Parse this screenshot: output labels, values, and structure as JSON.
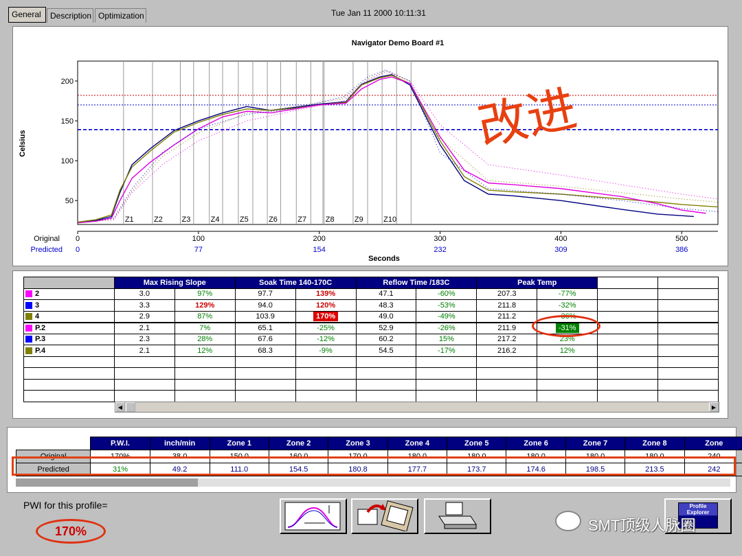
{
  "tabs": [
    "General",
    "Description",
    "Optimization"
  ],
  "timestamp": "Tue Jan 11 2000 10:11:31",
  "chart_data": {
    "type": "line",
    "title": "Navigator Demo Board #1",
    "ylabel": "Celsius",
    "xlabel": "Seconds",
    "xlim": [
      0,
      530
    ],
    "ylim": [
      20,
      225
    ],
    "yticks": [
      50,
      100,
      150,
      200
    ],
    "x_original_ticks": [
      0,
      100,
      200,
      300,
      400,
      500
    ],
    "x_predicted_tick_labels": [
      "0",
      "77",
      "154",
      "232",
      "309",
      "386"
    ],
    "x_row_labels": {
      "original": "Original",
      "predicted": "Predicted"
    },
    "zones": [
      {
        "label": "Z1",
        "x": 38
      },
      {
        "label": "Z2",
        "x": 62
      },
      {
        "label": "Z3",
        "x": 85
      },
      {
        "label": "Z4",
        "x": 109
      },
      {
        "label": "Z5",
        "x": 133
      },
      {
        "label": "Z6",
        "x": 157
      },
      {
        "label": "Z7",
        "x": 181
      },
      {
        "label": "Z8",
        "x": 204
      },
      {
        "label": "Z9",
        "x": 228
      },
      {
        "label": "Z10",
        "x": 252
      }
    ],
    "zone_extra_lines": [
      96,
      120,
      145,
      168,
      193,
      203,
      240,
      264,
      276
    ],
    "hlines": [
      {
        "y": 182,
        "color": "#cc0000",
        "style": "dotted"
      },
      {
        "y": 170,
        "color": "#0000cc",
        "style": "dotted"
      },
      {
        "y": 139,
        "color": "#0000cc",
        "style": "dashed"
      }
    ],
    "series": [
      {
        "color": "#000080",
        "x": [
          0,
          15,
          28,
          35,
          45,
          60,
          80,
          100,
          120,
          140,
          160,
          180,
          200,
          222,
          235,
          250,
          260,
          275,
          300,
          320,
          340,
          360,
          400,
          450,
          480,
          500,
          510
        ],
        "y": [
          23,
          25,
          30,
          60,
          95,
          115,
          138,
          150,
          160,
          168,
          163,
          167,
          171,
          174,
          196,
          205,
          208,
          195,
          120,
          75,
          58,
          56,
          50,
          39,
          33,
          31,
          30
        ]
      },
      {
        "color": "#808000",
        "x": [
          0,
          15,
          28,
          35,
          45,
          60,
          80,
          100,
          120,
          140,
          160,
          180,
          200,
          222,
          235,
          250,
          260,
          275,
          300,
          320,
          340,
          360,
          400,
          450,
          480,
          500,
          530
        ],
        "y": [
          23,
          26,
          32,
          63,
          92,
          112,
          136,
          148,
          158,
          165,
          163,
          166,
          170,
          173,
          195,
          204,
          207,
          197,
          125,
          80,
          63,
          61,
          58,
          52,
          48,
          45,
          42
        ]
      },
      {
        "color": "#e000e0",
        "x": [
          0,
          15,
          28,
          35,
          45,
          60,
          80,
          100,
          120,
          140,
          160,
          180,
          200,
          222,
          235,
          250,
          260,
          275,
          300,
          320,
          340,
          360,
          400,
          450,
          480,
          500,
          520
        ],
        "y": [
          22,
          24,
          28,
          50,
          78,
          98,
          120,
          140,
          155,
          162,
          160,
          165,
          170,
          172,
          190,
          202,
          205,
          197,
          130,
          88,
          72,
          70,
          65,
          55,
          46,
          38,
          34
        ]
      },
      {
        "color": "#e000e0",
        "style": "dotted",
        "x": [
          0,
          30,
          45,
          70,
          100,
          140,
          180,
          220,
          240,
          255,
          275,
          300,
          340,
          400,
          450,
          500,
          530
        ],
        "y": [
          22,
          26,
          60,
          95,
          125,
          150,
          163,
          175,
          200,
          212,
          200,
          145,
          95,
          82,
          70,
          58,
          52
        ]
      },
      {
        "color": "#0000cc",
        "style": "dotted",
        "x": [
          0,
          30,
          45,
          70,
          100,
          140,
          180,
          220,
          240,
          255,
          275,
          300,
          340,
          400,
          450,
          500,
          530
        ],
        "y": [
          22,
          28,
          65,
          110,
          140,
          158,
          166,
          180,
          205,
          214,
          200,
          110,
          65,
          58,
          50,
          40,
          36
        ]
      },
      {
        "color": "#808000",
        "style": "dotted",
        "x": [
          0,
          30,
          45,
          70,
          100,
          140,
          180,
          220,
          240,
          255,
          275,
          300,
          340,
          400,
          450,
          500,
          530
        ],
        "y": [
          22,
          27,
          62,
          105,
          135,
          160,
          168,
          178,
          202,
          213,
          200,
          128,
          75,
          68,
          60,
          52,
          48
        ]
      }
    ]
  },
  "annotation_cjk": "改进",
  "grid": {
    "headers": [
      "Max Rising Slope",
      "Soak Time 140-170C",
      "Reflow Time /183C",
      "Peak Temp"
    ],
    "rows": [
      {
        "label": "2",
        "color": "#ff00ff",
        "cells": [
          "3.0",
          "97%",
          "97.7",
          "139%",
          "47.1",
          "-60%",
          "207.3",
          "-77%"
        ]
      },
      {
        "label": "3",
        "color": "#0000ff",
        "cells": [
          "3.3",
          "129%",
          "94.0",
          "120%",
          "48.3",
          "-53%",
          "211.8",
          "-32%"
        ]
      },
      {
        "label": "4",
        "color": "#808000",
        "cells": [
          "2.9",
          "87%",
          "103.9",
          "170%",
          "49.0",
          "-49%",
          "211.2",
          "-36%"
        ]
      },
      {
        "label": "P.2",
        "color": "#ff00ff",
        "cells": [
          "2.1",
          "7%",
          "65.1",
          "-25%",
          "52.9",
          "-26%",
          "211.9",
          "-31%"
        ]
      },
      {
        "label": "P.3",
        "color": "#0000ff",
        "cells": [
          "2.3",
          "28%",
          "67.6",
          "-12%",
          "60.2",
          "15%",
          "217.2",
          "23%"
        ]
      },
      {
        "label": "P.4",
        "color": "#808000",
        "cells": [
          "2.1",
          "12%",
          "68.3",
          "-9%",
          "54.5",
          "-17%",
          "216.2",
          "12%"
        ]
      }
    ]
  },
  "bottom": {
    "headers": [
      "P.W.I.",
      "inch/min",
      "Zone 1",
      "Zone 2",
      "Zone 3",
      "Zone 4",
      "Zone 5",
      "Zone 6",
      "Zone 7",
      "Zone 8",
      "Zone"
    ],
    "original_label": "Original",
    "original": [
      "170%",
      "38.0",
      "150.0",
      "160.0",
      "170.0",
      "180.0",
      "180.0",
      "180.0",
      "180.0",
      "180.0",
      "240"
    ],
    "predicted_label": "Predicted",
    "predicted": [
      "31%",
      "49.2",
      "111.0",
      "154.5",
      "180.8",
      "177.7",
      "173.7",
      "174.6",
      "198.5",
      "213.5",
      "242"
    ]
  },
  "pwi_label": "PWI for this profile=",
  "pwi_value": "170%",
  "profile_explorer_label": "Profile Explorer",
  "watermark": "SMT顶级人脉圈"
}
